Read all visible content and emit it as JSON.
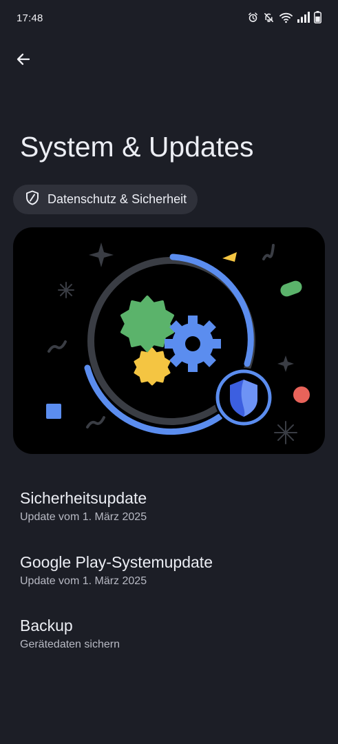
{
  "status_bar": {
    "time": "17:48",
    "icons": [
      "alarm-icon",
      "notifications-off-icon",
      "wifi-icon",
      "signal-icon",
      "battery-icon"
    ]
  },
  "header": {
    "back_icon": "arrow-left-icon",
    "title": "System & Updates"
  },
  "chip": {
    "icon": "shield-icon",
    "label": "Datenschutz & Sicherheit"
  },
  "hero": {
    "image": "system-update-illustration",
    "colors": {
      "ring": "#5b8def",
      "inner_ring": "#3a3d44",
      "gear_green": "#5bb36b",
      "gear_blue": "#5b8def",
      "gear_yellow": "#f4c542",
      "shield": "#3c5fe0",
      "accent_red": "#e8635a"
    }
  },
  "items": [
    {
      "title": "Sicherheitsupdate",
      "subtitle": "Update vom 1. März 2025"
    },
    {
      "title": "Google Play-Systemupdate",
      "subtitle": "Update vom 1. März 2025"
    },
    {
      "title": "Backup",
      "subtitle": "Gerätedaten sichern"
    }
  ],
  "theme": {
    "background": "#1c1e26",
    "chip_background": "#2f313a",
    "text_primary": "#eceef4",
    "text_secondary": "#b8bac4"
  }
}
